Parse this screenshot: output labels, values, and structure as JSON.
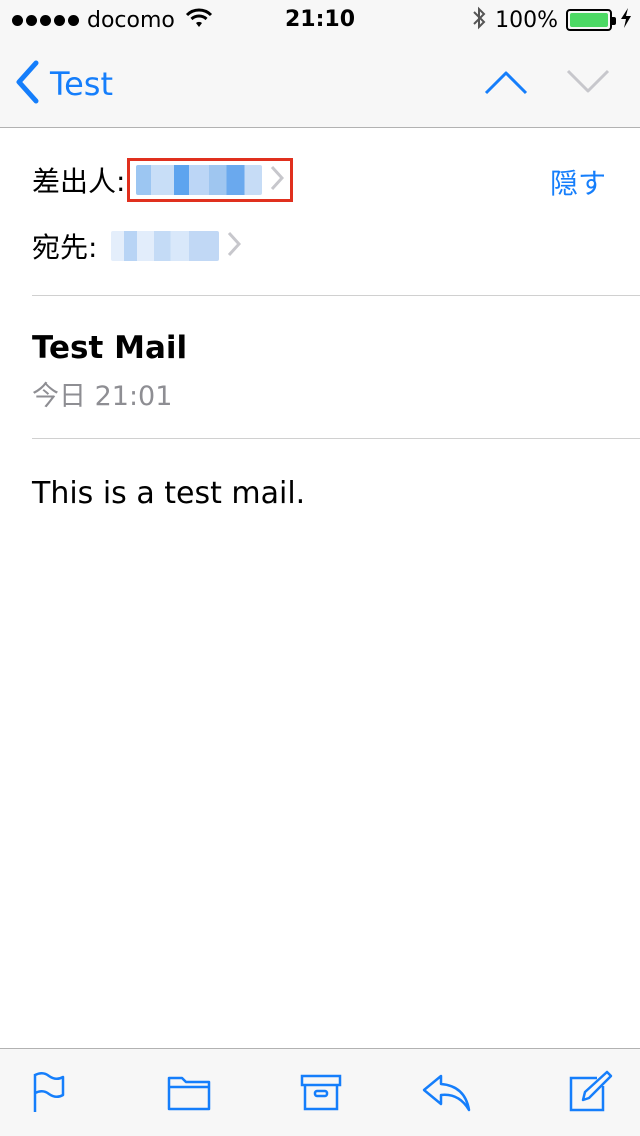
{
  "status_bar": {
    "carrier": "docomo",
    "time": "21:10",
    "battery_percent": "100%",
    "battery_level": 1.0,
    "signal_bars": 5
  },
  "nav": {
    "back_label": "Test",
    "icons": {
      "back": "chevron-left-icon",
      "previous": "chevron-up-icon",
      "next": "chevron-down-icon"
    }
  },
  "header": {
    "from_label": "差出人:",
    "to_label": "宛先:",
    "hide_label": "隠す"
  },
  "message": {
    "subject": "Test Mail",
    "date": "今日 21:01",
    "body": "This is a test mail."
  },
  "toolbar": {
    "icons": [
      "flag-icon",
      "folder-icon",
      "archive-icon",
      "reply-icon",
      "compose-icon"
    ]
  },
  "colors": {
    "accent": "#157efb",
    "highlight_box": "#e0301e",
    "battery": "#4cd964",
    "secondary_text": "#8e8e93"
  }
}
